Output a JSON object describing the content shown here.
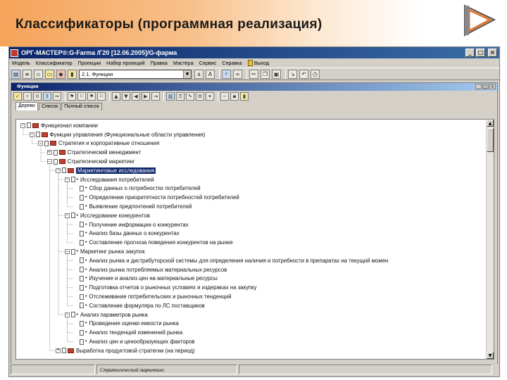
{
  "slide": {
    "title": "Классификаторы (программная реализация)"
  },
  "window": {
    "title": "ОРГ-МАСТЕР®:G-Farma /Г20 [12.06.2005]/G-фарма",
    "controls": [
      "_",
      "□",
      "×"
    ]
  },
  "menu": {
    "items": [
      "Модель",
      "Классификатор",
      "Проекции",
      "Набор проекций",
      "Правка",
      "Мастера",
      "Сервис",
      "Справка",
      "Выход"
    ]
  },
  "toolbar": {
    "view_value": "2.1. Функции"
  },
  "subwindow": {
    "title": "Функции"
  },
  "tabs": [
    {
      "label": "Дерево",
      "active": true
    },
    {
      "label": "Список",
      "active": false
    },
    {
      "label": "Полный список",
      "active": false
    }
  ],
  "tree": [
    {
      "level": 0,
      "expander": "-",
      "kind": "folder",
      "label": "Функционал компании"
    },
    {
      "level": 1,
      "expander": "-",
      "kind": "folder",
      "label": "Функции управления (Функциональные области управления)"
    },
    {
      "level": 2,
      "expander": "-",
      "kind": "folder",
      "label": "Стратегия и корпоративные отношения"
    },
    {
      "level": 3,
      "expander": "+",
      "kind": "folder",
      "label": "Стратегический менеджмент"
    },
    {
      "level": 3,
      "expander": "-",
      "kind": "folder",
      "label": "Стратегический маркетинг"
    },
    {
      "level": 4,
      "expander": "-",
      "kind": "folder",
      "label": "Маркетинговые исследования",
      "selected": true
    },
    {
      "level": 5,
      "expander": "-",
      "kind": "bullet",
      "label": "Исследования потребителей"
    },
    {
      "level": 6,
      "expander": "",
      "kind": "bullet",
      "label": "Сбор данных о потребностях потребителей"
    },
    {
      "level": 6,
      "expander": "",
      "kind": "bullet",
      "label": "Определение приоритетности потребностей потребителей"
    },
    {
      "level": 6,
      "expander": "",
      "kind": "bullet",
      "label": "Выявление предпочтений потребителей"
    },
    {
      "level": 5,
      "expander": "-",
      "kind": "bullet",
      "label": "Исследование конкурентов"
    },
    {
      "level": 6,
      "expander": "",
      "kind": "bullet",
      "label": "Получение информации о конкурентах"
    },
    {
      "level": 6,
      "expander": "",
      "kind": "bullet",
      "label": "Анализ базы данных о конкурентах"
    },
    {
      "level": 6,
      "expander": "",
      "kind": "bullet",
      "label": "Составление прогноза поведения конкурентов на рынке"
    },
    {
      "level": 5,
      "expander": "-",
      "kind": "bullet",
      "label": "Маркетинг рынка закупок"
    },
    {
      "level": 6,
      "expander": "",
      "kind": "bullet",
      "label": "Анализ рынка и дистрибуторской системы для определения наличия и потребности в препаратах на текущий момен"
    },
    {
      "level": 6,
      "expander": "",
      "kind": "bullet",
      "label": "Анализ рынка потребляемых материальных ресурсов"
    },
    {
      "level": 6,
      "expander": "",
      "kind": "bullet",
      "label": "Изучение и анализ цен на материальные ресурсы"
    },
    {
      "level": 6,
      "expander": "",
      "kind": "bullet",
      "label": "Подготовка отчетов о рыночных условиях и издержках на закупку"
    },
    {
      "level": 6,
      "expander": "",
      "kind": "bullet",
      "label": "Отслеживание потребительских и рыночных тенденций"
    },
    {
      "level": 6,
      "expander": "",
      "kind": "bullet",
      "label": "Составление формуляра по ЛС поставщиков"
    },
    {
      "level": 5,
      "expander": "-",
      "kind": "bullet",
      "label": "Анализ параметров рынка"
    },
    {
      "level": 6,
      "expander": "",
      "kind": "bullet",
      "label": "Проведение оценки емкости рынка"
    },
    {
      "level": 6,
      "expander": "",
      "kind": "bullet",
      "label": "Анализ тенденций изменений рынка"
    },
    {
      "level": 6,
      "expander": "",
      "kind": "bullet",
      "label": "Анализ цен и ценообразующих факторов"
    },
    {
      "level": 4,
      "expander": "+",
      "kind": "folder",
      "label": "Выработка продуктовой стратегии (на период)"
    }
  ],
  "statusbar": {
    "path": "Стратегический маркетинг"
  }
}
